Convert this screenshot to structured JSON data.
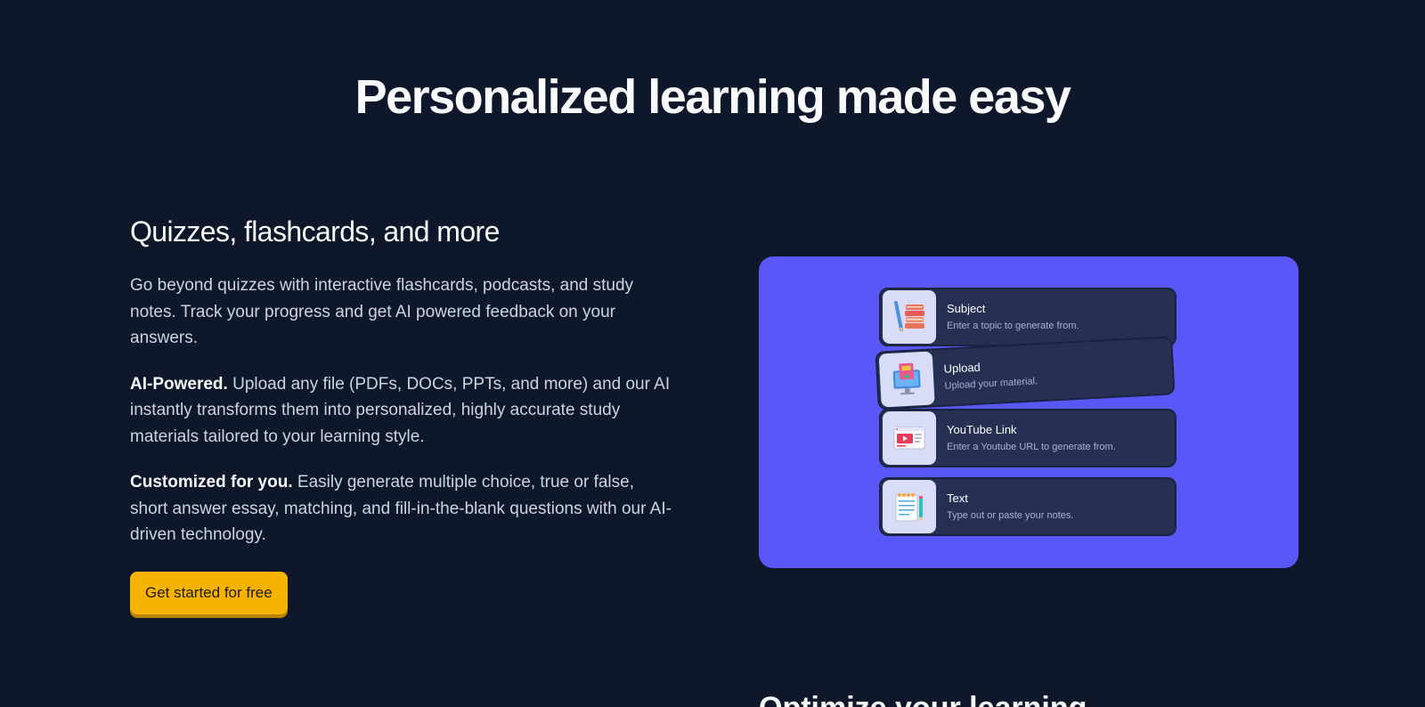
{
  "hero": {
    "title": "Personalized learning made easy"
  },
  "feature": {
    "heading": "Quizzes, flashcards, and more",
    "intro": "Go beyond quizzes with interactive flashcards, podcasts, and study notes. Track your progress and get AI powered feedback on your answers.",
    "ai_label": "AI-Powered.",
    "ai_text": " Upload any file (PDFs, DOCs, PPTs, and more) and our AI instantly transforms them into personalized, highly accurate study materials tailored to your learning style.",
    "custom_label": "Customized for you.",
    "custom_text": " Easily generate multiple choice, true or false, short answer essay, matching, and fill-in-the-blank questions with our AI-driven technology.",
    "cta_label": "Get started for free"
  },
  "illustration": {
    "background_color": "#5a57f8",
    "cards": [
      {
        "title": "Subject",
        "subtitle": "Enter a topic to generate from.",
        "icon": "books-icon"
      },
      {
        "title": "Upload",
        "subtitle": "Upload your material.",
        "icon": "monitor-upload-icon"
      },
      {
        "title": "YouTube Link",
        "subtitle": "Enter a Youtube URL to generate from.",
        "icon": "video-player-icon"
      },
      {
        "title": "Text",
        "subtitle": "Type out or paste your notes.",
        "icon": "notepad-icon"
      }
    ]
  },
  "next_section": {
    "heading_partial": "Optimize your learning"
  },
  "colors": {
    "background": "#0f172a",
    "accent": "#f5b300"
  }
}
